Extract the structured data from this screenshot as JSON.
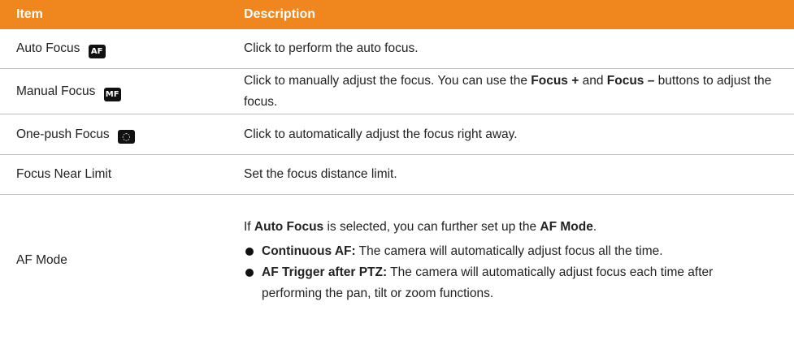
{
  "header": {
    "item": "Item",
    "description": "Description"
  },
  "rows": [
    {
      "item": "Auto Focus",
      "icon": "AF",
      "desc": "Click to perform the auto focus."
    },
    {
      "item": "Manual Focus",
      "icon": "MF",
      "desc_pre": "Click to manually adjust the focus. You can use the ",
      "desc_b1": "Focus +",
      "desc_mid": " and ",
      "desc_b2": "Focus –",
      "desc_post": " buttons to adjust the focus."
    },
    {
      "item": "One-push Focus",
      "icon": "◌",
      "desc": "Click to automatically adjust the focus right away."
    },
    {
      "item": "Focus Near Limit",
      "desc": "Set the focus distance limit."
    },
    {
      "item": "AF Mode",
      "intro_pre": "If ",
      "intro_b1": "Auto Focus",
      "intro_mid": " is selected, you can further set up the ",
      "intro_b2": "AF Mode",
      "intro_post": ".",
      "bullets": [
        {
          "label": "Continuous AF:",
          "text": " The camera will automatically adjust focus all the time."
        },
        {
          "label": "AF Trigger after PTZ:",
          "text": " The camera will automatically adjust focus each time after performing the pan, tilt or zoom functions."
        }
      ]
    }
  ]
}
